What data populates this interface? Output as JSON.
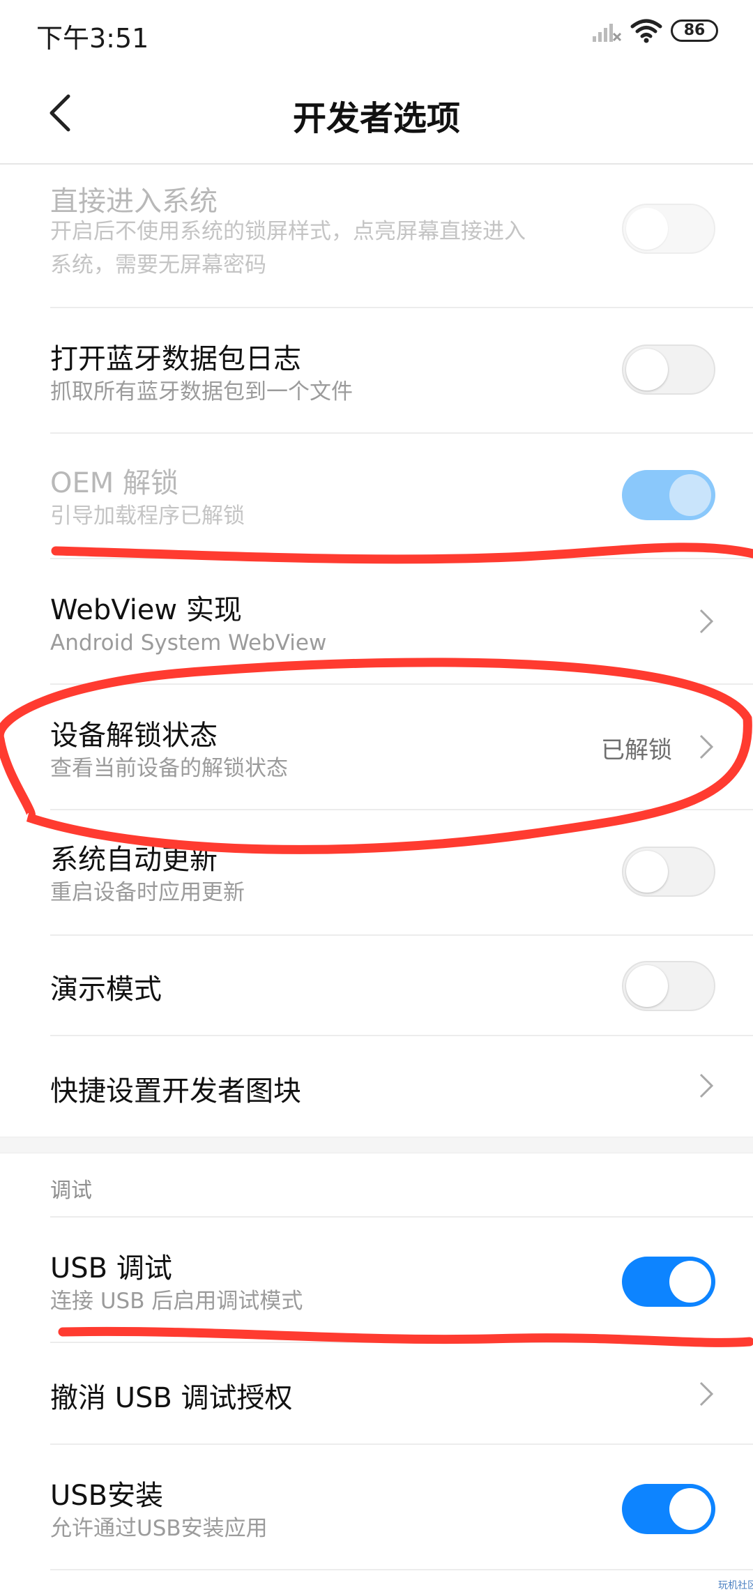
{
  "status_bar": {
    "time": "下午3:51",
    "battery": "86"
  },
  "header": {
    "title": "开发者选项"
  },
  "rows": [
    {
      "title": "直接进入系统",
      "subtitle_1": "开启后不使用系统的锁屏样式，点亮屏幕直接进入",
      "subtitle_2": "系统，需要无屏幕密码",
      "toggle": "off",
      "enabled": false
    },
    {
      "title": "打开蓝牙数据包日志",
      "subtitle": "抓取所有蓝牙数据包到一个文件",
      "toggle": "off",
      "enabled": true
    },
    {
      "title": "OEM 解锁",
      "subtitle": "引导加载程序已解锁",
      "toggle": "on",
      "enabled": false
    },
    {
      "title": "WebView 实现",
      "subtitle": "Android System WebView",
      "control": "chevron"
    },
    {
      "title": "设备解锁状态",
      "subtitle": "查看当前设备的解锁状态",
      "value": "已解锁",
      "control": "chevron"
    },
    {
      "title": "系统自动更新",
      "subtitle": "重启设备时应用更新",
      "toggle": "off",
      "enabled": true
    },
    {
      "title": "演示模式",
      "toggle": "off",
      "enabled": true
    },
    {
      "title": "快捷设置开发者图块",
      "control": "chevron"
    }
  ],
  "debug_section": {
    "label": "调试",
    "rows": [
      {
        "title": "USB 调试",
        "subtitle": "连接 USB 后启用调试模式",
        "toggle": "on",
        "enabled": true
      },
      {
        "title": "撤消 USB 调试授权",
        "control": "chevron"
      },
      {
        "title": "USB安装",
        "subtitle": "允许通过USB安装应用",
        "toggle": "on",
        "enabled": true
      }
    ]
  },
  "watermark": "玩机社区",
  "colors": {
    "accent": "#0d84ff",
    "annotation": "#ff3b30"
  }
}
